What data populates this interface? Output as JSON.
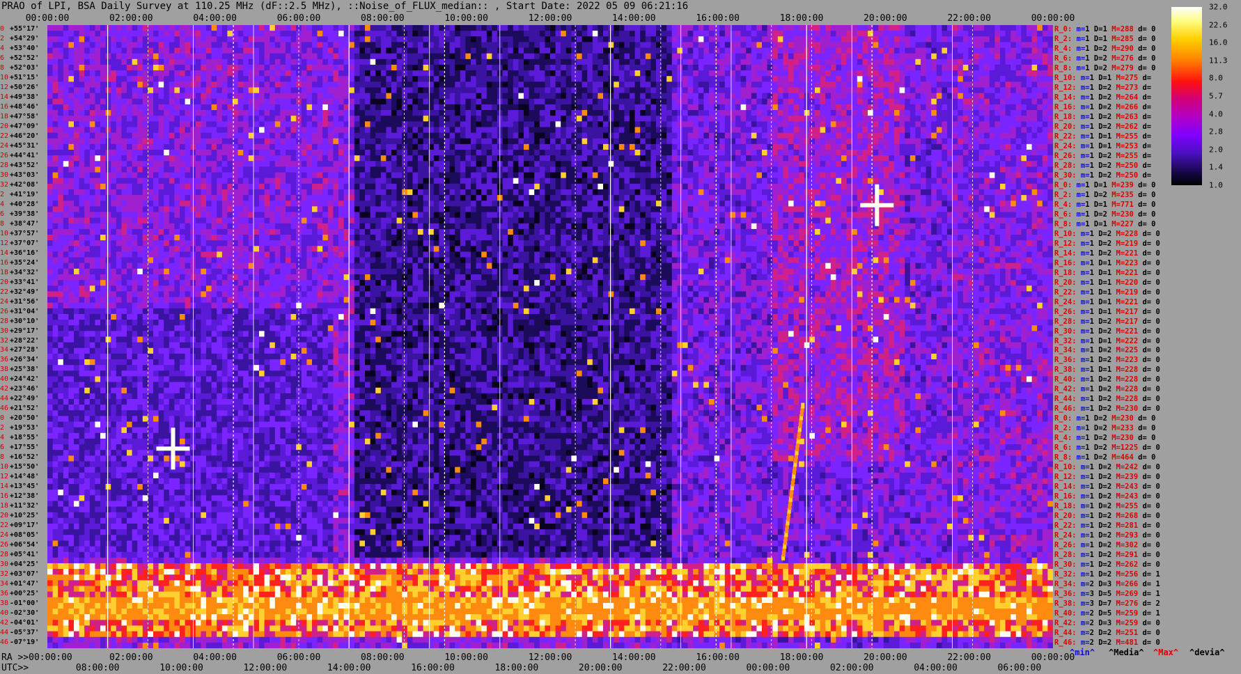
{
  "title": "PRAO of LPI, BSA Daily Survey at 110.25 MHz (dF::2.5 MHz), ::Noise_of_FLUX_median:: , Start Date: 2022 05 09 06:21:16",
  "x_top_ticks": [
    "00:00:00",
    "02:00:00",
    "04:00:00",
    "06:00:00",
    "08:00:00",
    "10:00:00",
    "12:00:00",
    "14:00:00",
    "16:00:00",
    "18:00:00",
    "20:00:00",
    "22:00:00",
    "00:00:00"
  ],
  "ra_label": "RA >>00:00:00",
  "ra_ticks": [
    "02:00:00",
    "04:00:00",
    "06:00:00",
    "08:00:00",
    "10:00:00",
    "12:00:00",
    "14:00:00",
    "16:00:00",
    "18:00:00",
    "20:00:00",
    "22:00:00",
    "00:00:00"
  ],
  "utc_label": "UTC>>",
  "utc_ticks": [
    "08:00:00",
    "10:00:00",
    "12:00:00",
    "14:00:00",
    "16:00:00",
    "18:00:00",
    "20:00:00",
    "22:00:00",
    "00:00:00",
    "02:00:00",
    "04:00:00",
    "06:00:00"
  ],
  "colorbar": {
    "ticks": [
      "32.0",
      "22.6",
      "16.0",
      "11.3",
      "8.0",
      "5.7",
      "4.0",
      "2.8",
      "2.0",
      "1.4",
      "1.0"
    ],
    "colors": [
      "#000000",
      "#1a0850",
      "#4a10c0",
      "#8000ff",
      "#b000c8",
      "#d0007a",
      "#ff1010",
      "#ff8000",
      "#ffd000",
      "#fffd80",
      "#ffffff"
    ]
  },
  "legend": {
    "min": "^min^",
    "median": "^Media^",
    "max": "^Max^",
    "devia": "^devia^"
  },
  "chart_data": {
    "type": "heatmap",
    "xlabel": "",
    "ylabel": "",
    "declinations": [
      {
        "idx": "0",
        "dec": "+55°17'"
      },
      {
        "idx": "2",
        "dec": "+54°29'"
      },
      {
        "idx": "4",
        "dec": "+53°40'"
      },
      {
        "idx": "6",
        "dec": "+52°52'"
      },
      {
        "idx": "8",
        "dec": "+52°03'"
      },
      {
        "idx": "10",
        "dec": "+51°15'"
      },
      {
        "idx": "12",
        "dec": "+50°26'"
      },
      {
        "idx": "14",
        "dec": "+49°38'"
      },
      {
        "idx": "16",
        "dec": "+48°46'"
      },
      {
        "idx": "18",
        "dec": "+47°58'"
      },
      {
        "idx": "20",
        "dec": "+47°09'"
      },
      {
        "idx": "22",
        "dec": "+46°20'"
      },
      {
        "idx": "24",
        "dec": "+45°31'"
      },
      {
        "idx": "26",
        "dec": "+44°41'"
      },
      {
        "idx": "28",
        "dec": "+43°52'"
      },
      {
        "idx": "30",
        "dec": "+43°03'"
      },
      {
        "idx": "32",
        "dec": "+42°08'"
      },
      {
        "idx": "2",
        "dec": "+41°19'"
      },
      {
        "idx": "4",
        "dec": "+40°28'"
      },
      {
        "idx": "6",
        "dec": "+39°38'"
      },
      {
        "idx": "8",
        "dec": "+38°47'"
      },
      {
        "idx": "10",
        "dec": "+37°57'"
      },
      {
        "idx": "12",
        "dec": "+37°07'"
      },
      {
        "idx": "14",
        "dec": "+36°16'"
      },
      {
        "idx": "16",
        "dec": "+35°24'"
      },
      {
        "idx": "18",
        "dec": "+34°32'"
      },
      {
        "idx": "20",
        "dec": "+33°41'"
      },
      {
        "idx": "22",
        "dec": "+32°49'"
      },
      {
        "idx": "24",
        "dec": "+31°56'"
      },
      {
        "idx": "26",
        "dec": "+31°04'"
      },
      {
        "idx": "28",
        "dec": "+30°10'"
      },
      {
        "idx": "30",
        "dec": "+29°17'"
      },
      {
        "idx": "32",
        "dec": "+28°22'"
      },
      {
        "idx": "34",
        "dec": "+27°28'"
      },
      {
        "idx": "36",
        "dec": "+26°34'"
      },
      {
        "idx": "38",
        "dec": "+25°38'"
      },
      {
        "idx": "40",
        "dec": "+24°42'"
      },
      {
        "idx": "42",
        "dec": "+23°46'"
      },
      {
        "idx": "44",
        "dec": "+22°49'"
      },
      {
        "idx": "46",
        "dec": "+21°52'"
      },
      {
        "idx": "0",
        "dec": "+20°50'"
      },
      {
        "idx": "2",
        "dec": "+19°53'"
      },
      {
        "idx": "4",
        "dec": "+18°55'"
      },
      {
        "idx": "6",
        "dec": "+17°55'"
      },
      {
        "idx": "8",
        "dec": "+16°52'"
      },
      {
        "idx": "10",
        "dec": "+15°50'"
      },
      {
        "idx": "12",
        "dec": "+14°48'"
      },
      {
        "idx": "14",
        "dec": "+13°45'"
      },
      {
        "idx": "16",
        "dec": "+12°38'"
      },
      {
        "idx": "18",
        "dec": "+11°32'"
      },
      {
        "idx": "20",
        "dec": "+10°25'"
      },
      {
        "idx": "22",
        "dec": "+09°17'"
      },
      {
        "idx": "24",
        "dec": "+08°05'"
      },
      {
        "idx": "26",
        "dec": "+06°54'"
      },
      {
        "idx": "28",
        "dec": "+05°41'"
      },
      {
        "idx": "30",
        "dec": "+04°25'"
      },
      {
        "idx": "32",
        "dec": "+03°07'"
      },
      {
        "idx": "34",
        "dec": "+01°47'"
      },
      {
        "idx": "36",
        "dec": "+00°25'"
      },
      {
        "idx": "38",
        "dec": "-01°00'"
      },
      {
        "idx": "40",
        "dec": "-02°30'"
      },
      {
        "idx": "42",
        "dec": "-04°01'"
      },
      {
        "idx": "44",
        "dec": "-05°37'"
      },
      {
        "idx": "46",
        "dec": "-07°19'"
      }
    ],
    "stats": [
      {
        "r": "R_0:",
        "m": "1",
        "d": "1",
        "h": "288",
        "dd": "0"
      },
      {
        "r": "R_2:",
        "m": "1",
        "d": "1",
        "h": "285",
        "dd": "0"
      },
      {
        "r": "R_4:",
        "m": "1",
        "d": "2",
        "h": "290",
        "dd": "0"
      },
      {
        "r": "R_6:",
        "m": "1",
        "d": "2",
        "h": "276",
        "dd": "0"
      },
      {
        "r": "R_8:",
        "m": "1",
        "d": "2",
        "h": "279",
        "dd": "0"
      },
      {
        "r": "R_10:",
        "m": "1",
        "d": "1",
        "h": "275",
        "dd": ""
      },
      {
        "r": "R_12:",
        "m": "1",
        "d": "2",
        "h": "273",
        "dd": ""
      },
      {
        "r": "R_14:",
        "m": "1",
        "d": "2",
        "h": "264",
        "dd": ""
      },
      {
        "r": "R_16:",
        "m": "1",
        "d": "2",
        "h": "266",
        "dd": ""
      },
      {
        "r": "R_18:",
        "m": "1",
        "d": "2",
        "h": "263",
        "dd": ""
      },
      {
        "r": "R_20:",
        "m": "1",
        "d": "2",
        "h": "262",
        "dd": ""
      },
      {
        "r": "R_22:",
        "m": "1",
        "d": "1",
        "h": "255",
        "dd": ""
      },
      {
        "r": "R_24:",
        "m": "1",
        "d": "1",
        "h": "253",
        "dd": ""
      },
      {
        "r": "R_26:",
        "m": "1",
        "d": "2",
        "h": "255",
        "dd": ""
      },
      {
        "r": "R_28:",
        "m": "1",
        "d": "2",
        "h": "250",
        "dd": ""
      },
      {
        "r": "R_30:",
        "m": "1",
        "d": "2",
        "h": "250",
        "dd": ""
      },
      {
        "r": "R_0:",
        "m": "1",
        "d": "1",
        "h": "239",
        "dd": "0"
      },
      {
        "r": "R_2:",
        "m": "1",
        "d": "2",
        "h": "235",
        "dd": "0"
      },
      {
        "r": "R_4:",
        "m": "1",
        "d": "1",
        "h": "771",
        "dd": "0"
      },
      {
        "r": "R_6:",
        "m": "1",
        "d": "2",
        "h": "230",
        "dd": "0"
      },
      {
        "r": "R_8:",
        "m": "1",
        "d": "1",
        "h": "227",
        "dd": "0"
      },
      {
        "r": "R_10:",
        "m": "1",
        "d": "2",
        "h": "228",
        "dd": "0"
      },
      {
        "r": "R_12:",
        "m": "1",
        "d": "2",
        "h": "219",
        "dd": "0"
      },
      {
        "r": "R_14:",
        "m": "1",
        "d": "2",
        "h": "221",
        "dd": "0"
      },
      {
        "r": "R_16:",
        "m": "1",
        "d": "1",
        "h": "223",
        "dd": "0"
      },
      {
        "r": "R_18:",
        "m": "1",
        "d": "1",
        "h": "221",
        "dd": "0"
      },
      {
        "r": "R_20:",
        "m": "1",
        "d": "1",
        "h": "220",
        "dd": "0"
      },
      {
        "r": "R_22:",
        "m": "1",
        "d": "1",
        "h": "219",
        "dd": "0"
      },
      {
        "r": "R_24:",
        "m": "1",
        "d": "1",
        "h": "221",
        "dd": "0"
      },
      {
        "r": "R_26:",
        "m": "1",
        "d": "1",
        "h": "217",
        "dd": "0"
      },
      {
        "r": "R_28:",
        "m": "1",
        "d": "2",
        "h": "217",
        "dd": "0"
      },
      {
        "r": "R_30:",
        "m": "1",
        "d": "2",
        "h": "221",
        "dd": "0"
      },
      {
        "r": "R_32:",
        "m": "1",
        "d": "1",
        "h": "222",
        "dd": "0"
      },
      {
        "r": "R_34:",
        "m": "1",
        "d": "2",
        "h": "225",
        "dd": "0"
      },
      {
        "r": "R_36:",
        "m": "1",
        "d": "2",
        "h": "223",
        "dd": "0"
      },
      {
        "r": "R_38:",
        "m": "1",
        "d": "1",
        "h": "228",
        "dd": "0"
      },
      {
        "r": "R_40:",
        "m": "1",
        "d": "2",
        "h": "228",
        "dd": "0"
      },
      {
        "r": "R_42:",
        "m": "1",
        "d": "2",
        "h": "228",
        "dd": "0"
      },
      {
        "r": "R_44:",
        "m": "1",
        "d": "2",
        "h": "228",
        "dd": "0"
      },
      {
        "r": "R_46:",
        "m": "1",
        "d": "2",
        "h": "230",
        "dd": "0"
      },
      {
        "r": "R_0:",
        "m": "1",
        "d": "2",
        "h": "230",
        "dd": "0"
      },
      {
        "r": "R_2:",
        "m": "1",
        "d": "2",
        "h": "233",
        "dd": "0"
      },
      {
        "r": "R_4:",
        "m": "1",
        "d": "2",
        "h": "230",
        "dd": "0"
      },
      {
        "r": "R_6:",
        "m": "1",
        "d": "2",
        "h": "1225",
        "dd": "0"
      },
      {
        "r": "R_8:",
        "m": "1",
        "d": "2",
        "h": "464",
        "dd": "0"
      },
      {
        "r": "R_10:",
        "m": "1",
        "d": "2",
        "h": "242",
        "dd": "0"
      },
      {
        "r": "R_12:",
        "m": "1",
        "d": "2",
        "h": "239",
        "dd": "0"
      },
      {
        "r": "R_14:",
        "m": "1",
        "d": "2",
        "h": "243",
        "dd": "0"
      },
      {
        "r": "R_16:",
        "m": "1",
        "d": "2",
        "h": "243",
        "dd": "0"
      },
      {
        "r": "R_18:",
        "m": "1",
        "d": "2",
        "h": "255",
        "dd": "0"
      },
      {
        "r": "R_20:",
        "m": "1",
        "d": "2",
        "h": "268",
        "dd": "0"
      },
      {
        "r": "R_22:",
        "m": "1",
        "d": "2",
        "h": "281",
        "dd": "0"
      },
      {
        "r": "R_24:",
        "m": "1",
        "d": "2",
        "h": "293",
        "dd": "0"
      },
      {
        "r": "R_26:",
        "m": "1",
        "d": "2",
        "h": "302",
        "dd": "0"
      },
      {
        "r": "R_28:",
        "m": "1",
        "d": "2",
        "h": "291",
        "dd": "0"
      },
      {
        "r": "R_30:",
        "m": "1",
        "d": "2",
        "h": "262",
        "dd": "0"
      },
      {
        "r": "R_32:",
        "m": "1",
        "d": "2",
        "h": "256",
        "dd": "1"
      },
      {
        "r": "R_34:",
        "m": "2",
        "d": "3",
        "h": "266",
        "dd": "1"
      },
      {
        "r": "R_36:",
        "m": "3",
        "d": "5",
        "h": "269",
        "dd": "1"
      },
      {
        "r": "R_38:",
        "m": "3",
        "d": "7",
        "h": "276",
        "dd": "2"
      },
      {
        "r": "R_40:",
        "m": "2",
        "d": "5",
        "h": "259",
        "dd": "1"
      },
      {
        "r": "R_42:",
        "m": "2",
        "d": "3",
        "h": "259",
        "dd": "0"
      },
      {
        "r": "R_44:",
        "m": "2",
        "d": "2",
        "h": "251",
        "dd": "0"
      },
      {
        "r": "R_46:",
        "m": "2",
        "d": "2",
        "h": "481",
        "dd": "0"
      }
    ],
    "bright_sources": [
      {
        "name": "",
        "ra_hours": 3.0,
        "dec_row": 43
      },
      {
        "name": "",
        "ra_hours": 19.8,
        "dec_row": 18
      }
    ]
  }
}
